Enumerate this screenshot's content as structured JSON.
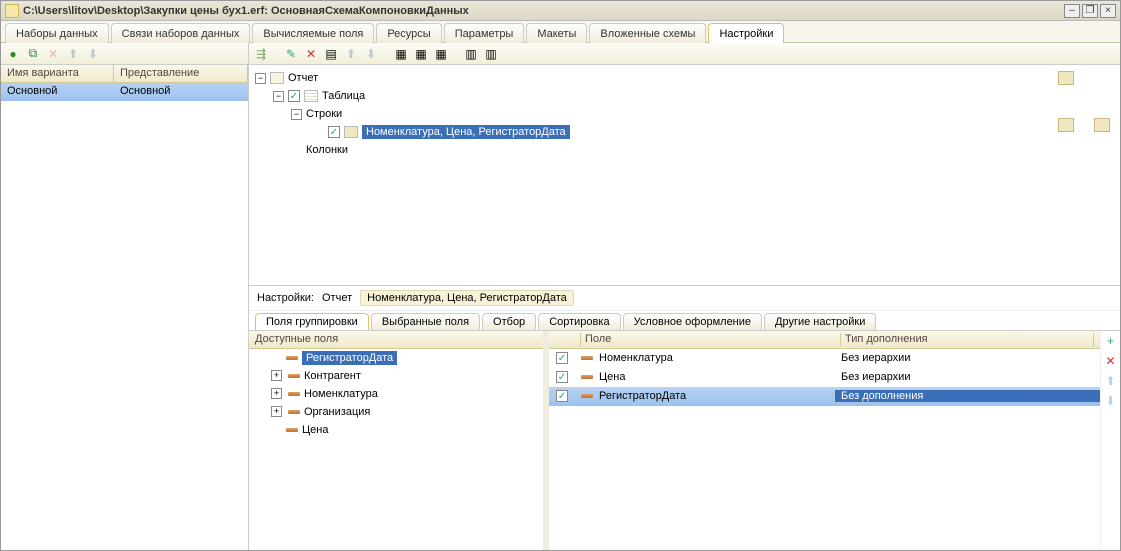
{
  "title": "C:\\Users\\litov\\Desktop\\Закупки цены бух1.erf: ОсновнаяСхемаКомпоновкиДанных",
  "tabs": [
    "Наборы данных",
    "Связи наборов данных",
    "Вычисляемые поля",
    "Ресурсы",
    "Параметры",
    "Макеты",
    "Вложенные схемы",
    "Настройки"
  ],
  "active_tab": "Настройки",
  "variants": {
    "cols": [
      "Имя варианта",
      "Представление"
    ],
    "rows": [
      {
        "name": "Основной",
        "repr": "Основной"
      }
    ]
  },
  "tree": {
    "root": "Отчет",
    "n1": "Таблица",
    "n2": "Строки",
    "n3": "Номенклатура, Цена, РегистраторДата",
    "n4": "Колонки"
  },
  "path": {
    "label": "Настройки:",
    "p1": "Отчет",
    "p2": "Номенклатура, Цена, РегистраторДата"
  },
  "subtabs": [
    "Поля группировки",
    "Выбранные поля",
    "Отбор",
    "Сортировка",
    "Условное оформление",
    "Другие настройки"
  ],
  "active_subtab": "Поля группировки",
  "avail": {
    "header": "Доступные поля",
    "items": [
      {
        "label": "РегистраторДата",
        "exp": false,
        "sel": true
      },
      {
        "label": "Контрагент",
        "exp": true,
        "sel": false
      },
      {
        "label": "Номенклатура",
        "exp": true,
        "sel": false
      },
      {
        "label": "Организация",
        "exp": true,
        "sel": false
      },
      {
        "label": "Цена",
        "exp": false,
        "sel": false
      }
    ]
  },
  "fields": {
    "cols": [
      "",
      "Поле",
      "Тип дополнения"
    ],
    "rows": [
      {
        "field": "Номенклатура",
        "type": "Без иерархии",
        "sel": false
      },
      {
        "field": "Цена",
        "type": "Без иерархии",
        "sel": false
      },
      {
        "field": "РегистраторДата",
        "type": "Без дополнения",
        "sel": true
      }
    ]
  }
}
